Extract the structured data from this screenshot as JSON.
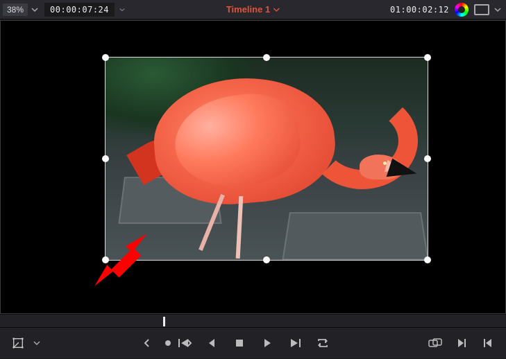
{
  "topbar": {
    "zoom_percent": "38%",
    "source_timecode": "00:00:07:24",
    "timeline_name": "Timeline 1",
    "record_timecode": "01:00:02:12"
  },
  "viewer": {
    "subject": "flamingo",
    "transform_handles": 8,
    "annotation": "drag-resize-arrow"
  },
  "transport": {
    "mode_label": "transform",
    "buttons": {
      "jump_first": "jump-to-first",
      "prev_frame": "previous-frame",
      "stop": "stop",
      "play": "play",
      "next_frame": "next-frame",
      "jump_last": "jump-to-last",
      "loop": "loop",
      "match_frame": "match-frame",
      "next_clip": "next-clip",
      "prev_clip": "previous-clip"
    }
  }
}
